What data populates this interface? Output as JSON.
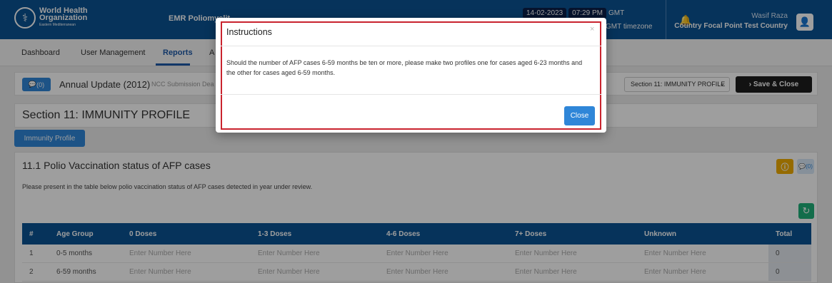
{
  "header": {
    "logo_line1": "World Health",
    "logo_line2": "Organization",
    "logo_line3": "Eastern Mediterranean",
    "app_title": "EMR Poliomyelit",
    "date": "14-02-2023",
    "time": "07:29 PM",
    "gmt": "GMT",
    "timezone": "GMT timezone",
    "user_name": "Wasif Raza",
    "user_role": "Country Focal Point Test Country"
  },
  "nav": {
    "items": [
      {
        "label": "Dashboard"
      },
      {
        "label": "User Management"
      },
      {
        "label": "Reports"
      },
      {
        "label": "A"
      }
    ]
  },
  "report_bar": {
    "comment_count": "(0)",
    "title": "Annual Update (2012)",
    "ncc_label": "NCC Submission Dea",
    "section_select": "Section 11: IMMUNITY PROFILE",
    "save_label": "Save & Close"
  },
  "section": {
    "title": "Section 11: IMMUNITY PROFILE",
    "tab_label": "Immunity Profile"
  },
  "card": {
    "title": "11.1 Polio Vaccination status of AFP cases",
    "comment_count": "(0)",
    "description": "Please present in the table below polio vaccination status of AFP cases detected in year under review."
  },
  "table": {
    "headers": [
      "#",
      "Age Group",
      "0 Doses",
      "1-3 Doses",
      "4-6 Doses",
      "7+ Doses",
      "Unknown",
      "Total"
    ],
    "placeholder": "Enter Number Here",
    "rows": [
      {
        "num": "1",
        "age": "0-5 months",
        "total": "0"
      },
      {
        "num": "2",
        "age": "6-59 months",
        "total": "0"
      }
    ]
  },
  "modal": {
    "title": "Instructions",
    "close_x": "×",
    "body": "Should the number of AFP cases 6-59 months be ten or more, please make two profiles one for cases aged 6-23 months and the other for cases aged 6-59 months.",
    "close_label": "Close"
  },
  "colors": {
    "header": "#0b5394",
    "primary": "#2f86d8",
    "highlight": "#c9232e",
    "warning": "#f0ad00",
    "success": "#20b07a"
  },
  "icons": {
    "logo": "who-emblem-icon",
    "bell": "bell-icon",
    "user": "user-icon",
    "comment": "comment-icon",
    "info": "info-icon",
    "refresh": "refresh-icon",
    "save": "chevron-right-icon",
    "caret": "chevron-down-icon"
  }
}
